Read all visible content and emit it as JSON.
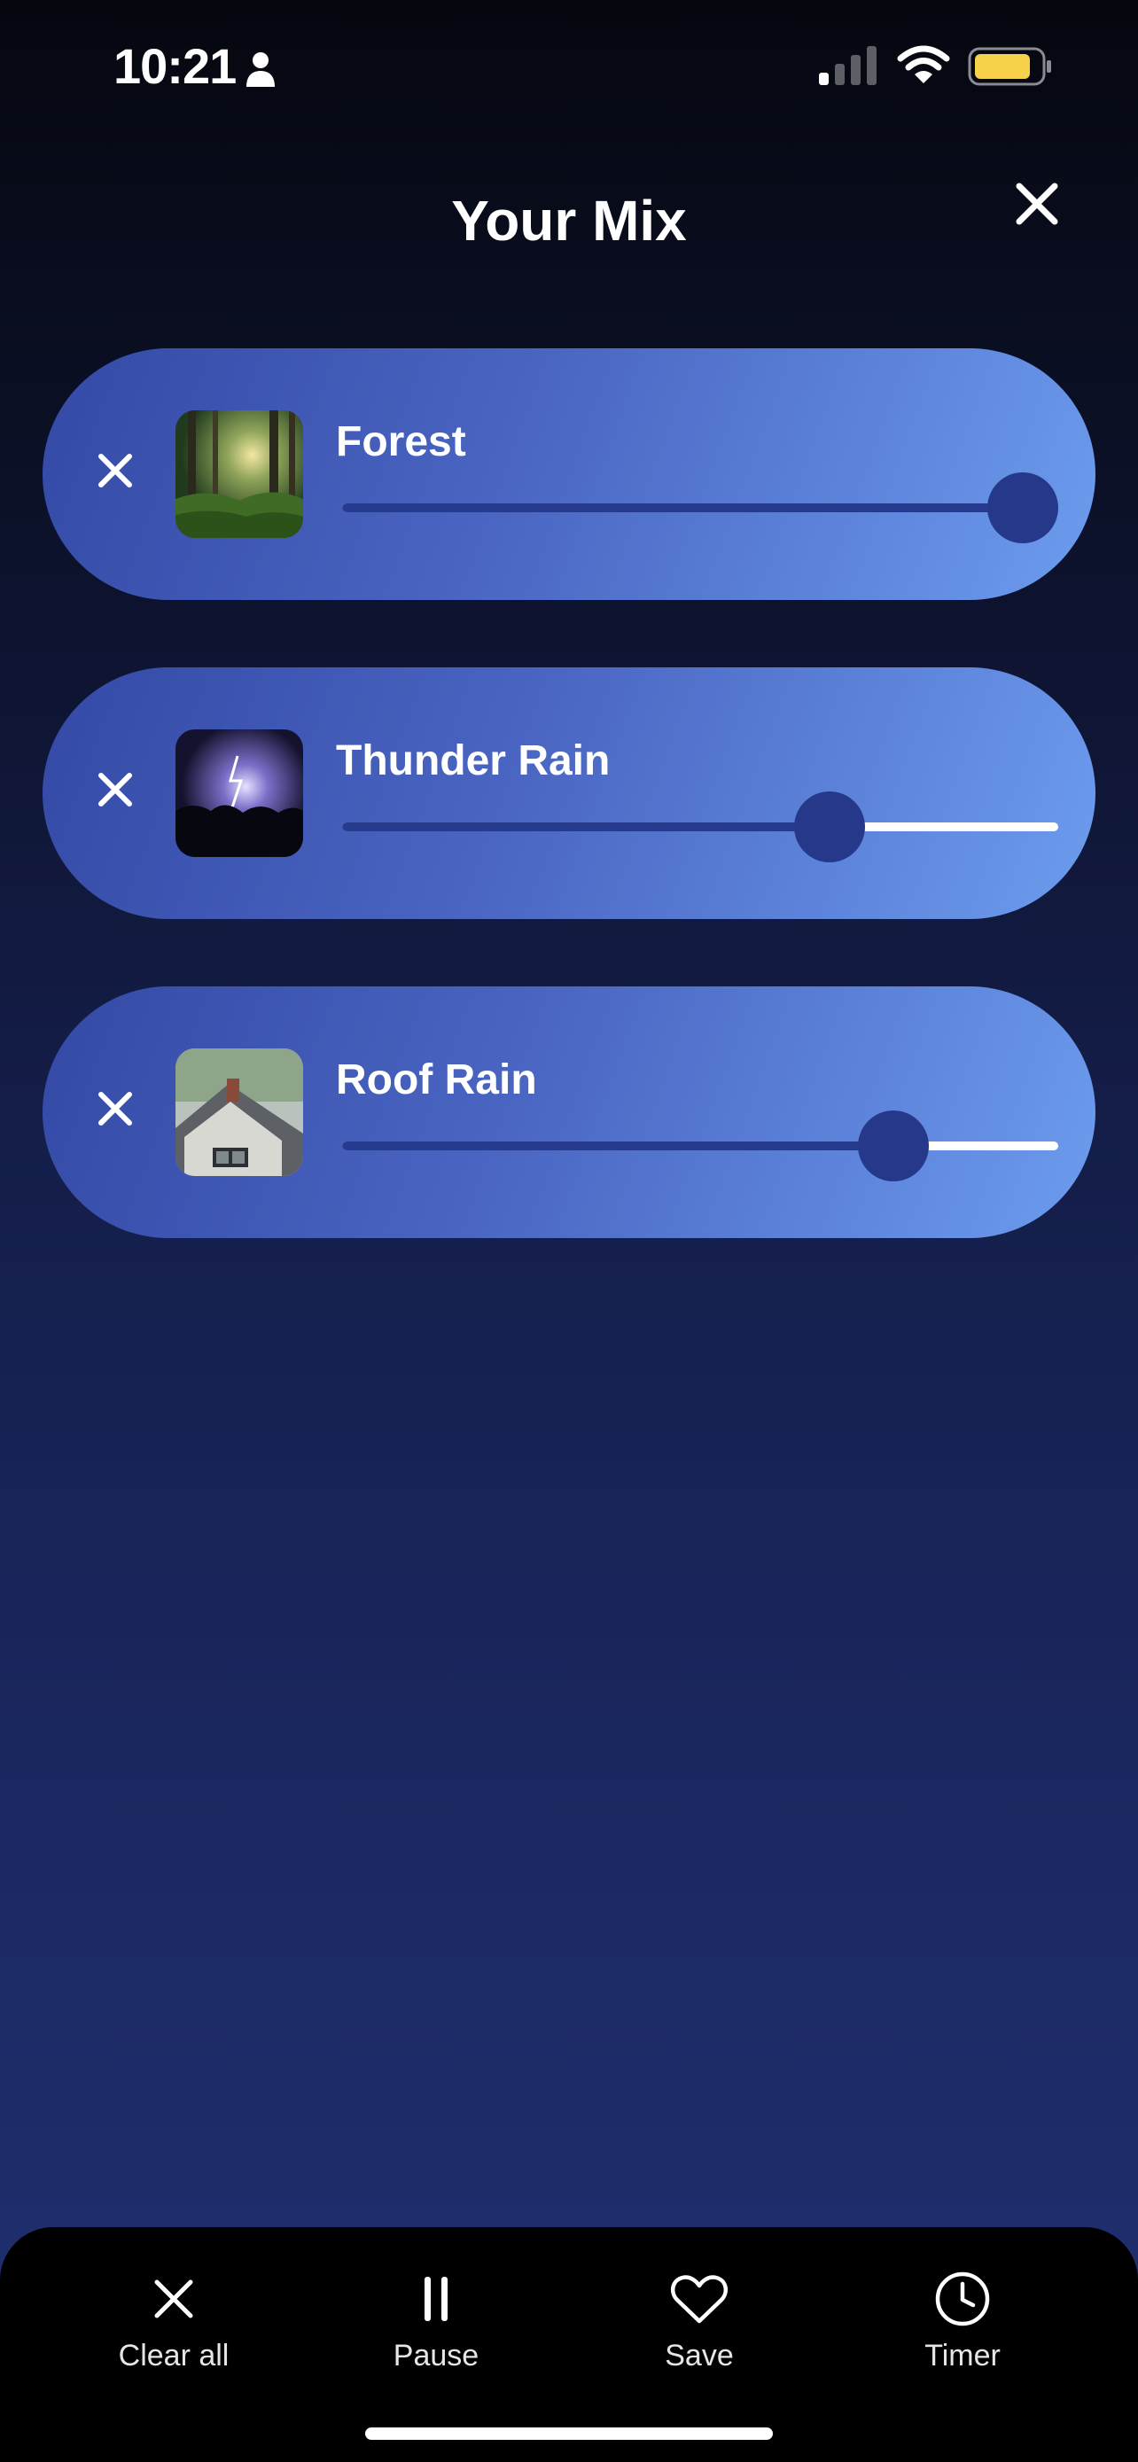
{
  "status_bar": {
    "time": "10:21"
  },
  "header": {
    "title": "Your Mix",
    "close_icon": "close-icon"
  },
  "sounds": [
    {
      "name": "Forest",
      "thumbnail": "forest-image",
      "volume": 1.0
    },
    {
      "name": "Thunder Rain",
      "thumbnail": "thunderstorm-image",
      "volume": 0.7
    },
    {
      "name": "Roof Rain",
      "thumbnail": "roof-rain-image",
      "volume": 0.8
    }
  ],
  "toolbar": {
    "items": [
      {
        "label": "Clear all",
        "icon": "close-icon"
      },
      {
        "label": "Pause",
        "icon": "pause-icon"
      },
      {
        "label": "Save",
        "icon": "heart-icon"
      },
      {
        "label": "Timer",
        "icon": "clock-icon"
      }
    ]
  },
  "colors": {
    "card_gradient_start": "#3449a6",
    "card_gradient_end": "#6c9cee",
    "slider_fill": "#263a8e",
    "slider_track": "#ffffff",
    "battery": "#f5d24a"
  }
}
